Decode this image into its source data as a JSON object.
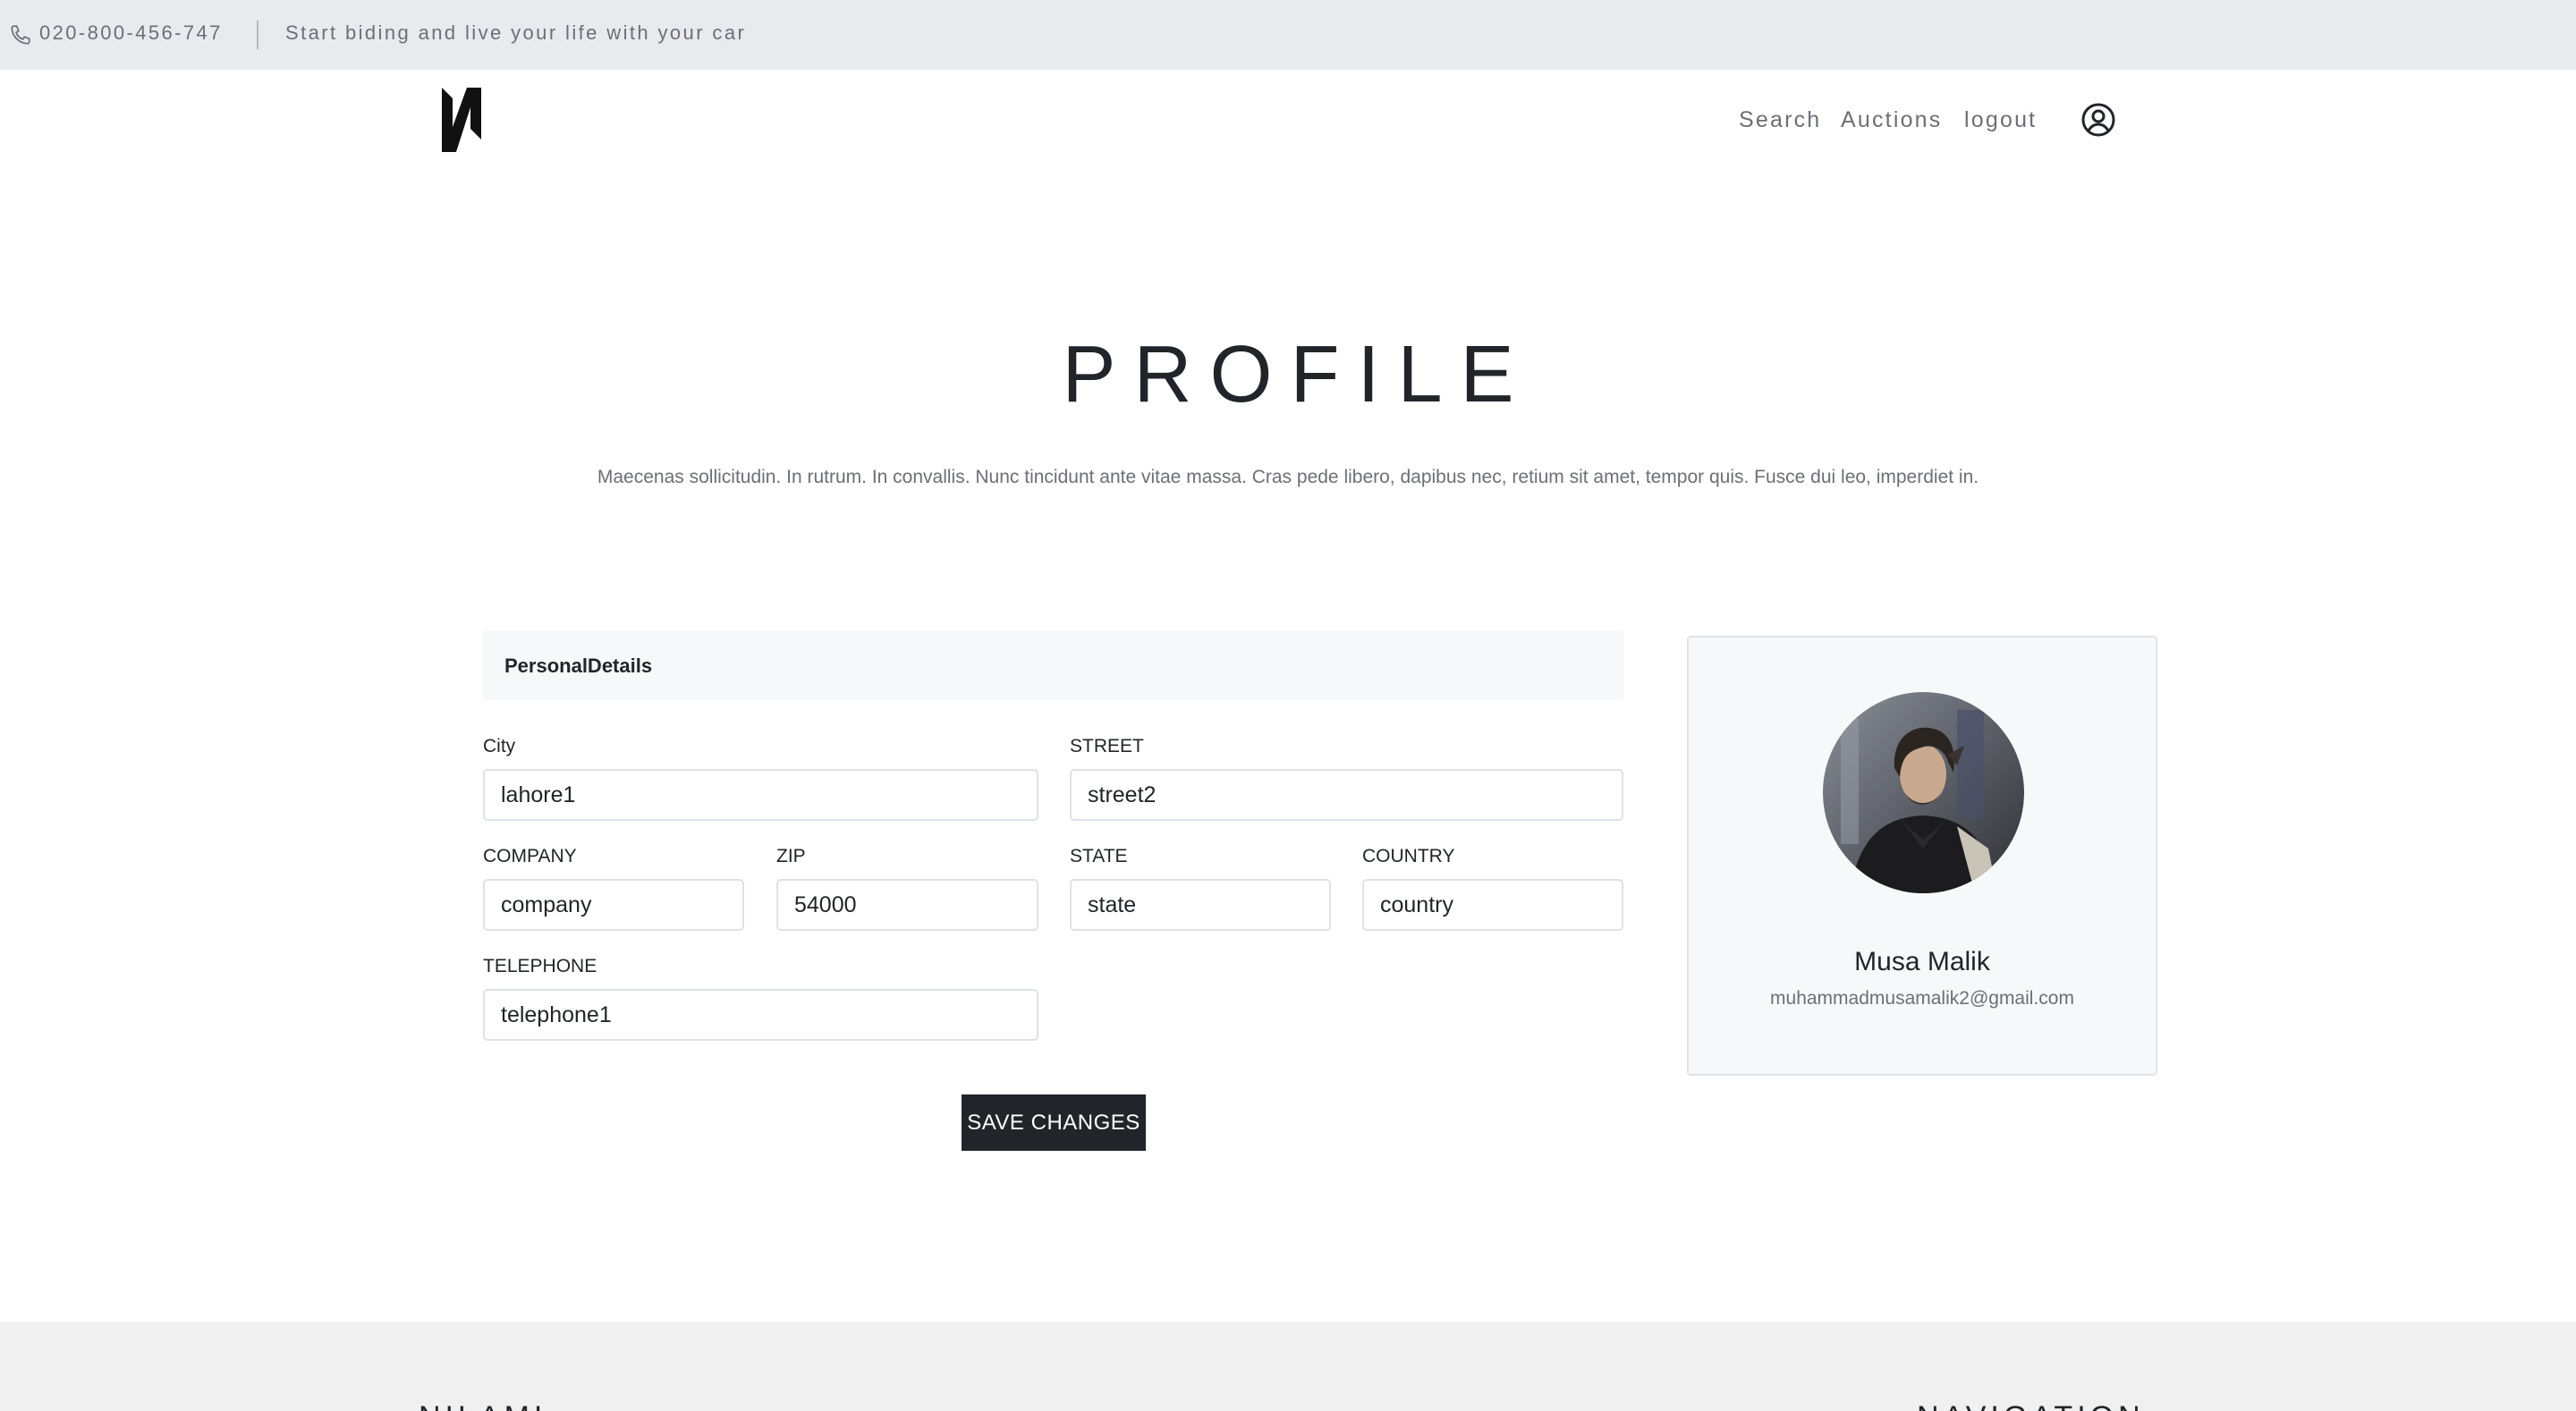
{
  "topbar": {
    "phone": "020-800-456-747",
    "tagline": "Start biding and live your life with your car"
  },
  "nav": {
    "search": "Search",
    "auctions": "Auctions",
    "logout": "logout"
  },
  "page": {
    "title": "PROFILE",
    "description": "Maecenas sollicitudin. In rutrum. In convallis. Nunc tincidunt ante vitae massa. Cras pede libero, dapibus nec, retium sit amet, tempor quis. Fusce dui leo, imperdiet in."
  },
  "form": {
    "header": "PersonalDetails",
    "city": {
      "label": "City",
      "value": "lahore1"
    },
    "street": {
      "label": "STREET",
      "value": "street2"
    },
    "company": {
      "label": "COMPANY",
      "value": "company"
    },
    "zip": {
      "label": "ZIP",
      "value": "54000"
    },
    "state": {
      "label": "STATE",
      "value": "state"
    },
    "country": {
      "label": "COUNTRY",
      "value": "country"
    },
    "telephone": {
      "label": "TELEPHONE",
      "value": "telephone1"
    },
    "save_label": "SAVE CHANGES"
  },
  "profile": {
    "name": "Musa Malik",
    "email": "muhammadmusamalik2@gmail.com"
  },
  "footer": {
    "brand": "NILAMI",
    "navigation": "NAVIGATION"
  },
  "icons": {
    "phone": "phone-icon",
    "user": "user-circle-icon",
    "logo": "logo-icon"
  }
}
